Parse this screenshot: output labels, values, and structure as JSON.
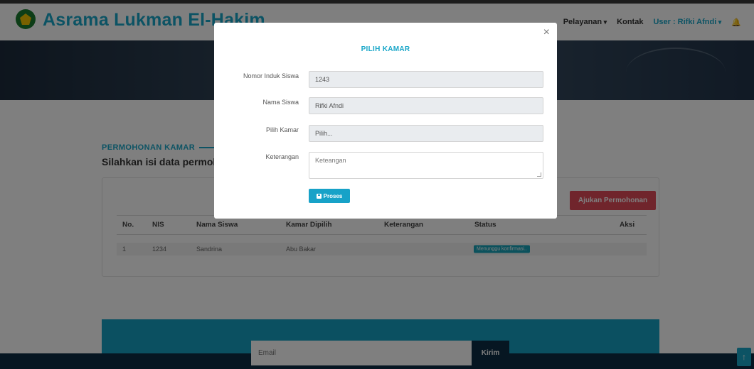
{
  "navbar": {
    "brand": "Asrama Lukman El-Hakim",
    "links": {
      "pelayanan": "Pelayanan",
      "kontak": "Kontak",
      "user": "User : Rifki Afndi"
    }
  },
  "section": {
    "tag": "PERMOHONAN KAMAR",
    "title": "Silahkan isi data permohonan"
  },
  "card": {
    "ajukan_label": "Ajukan Permohonan",
    "columns": [
      "No.",
      "NIS",
      "Nama Siswa",
      "Kamar Dipilih",
      "Keterangan",
      "Status",
      "Aksi"
    ],
    "rows": [
      {
        "no": "1",
        "nis": "1234",
        "nama": "Sandrina",
        "kamar": "Abu Bakar",
        "keterangan": "",
        "status": "Menunggu konfirmasi.."
      }
    ]
  },
  "footer": {
    "email_placeholder": "Email",
    "kirim_label": "Kirim"
  },
  "modal": {
    "title": "PILIH KAMAR",
    "close": "×",
    "fields": {
      "nis_label": "Nomor Induk Siswa",
      "nis_value": "1243",
      "nama_label": "Nama Siswa",
      "nama_value": "Rifki Afndi",
      "kamar_label": "Pilih Kamar",
      "kamar_value": "Pilih...",
      "keterangan_label": "Keterangan",
      "keterangan_placeholder": "Keteangan"
    },
    "submit_label": "Proses"
  },
  "icons": {
    "logo": "mosque-emblem-icon",
    "bell": "bell-icon",
    "save": "floppy-save-icon",
    "scroll_top": "arrow-up-icon"
  },
  "colors": {
    "primary": "#18a6c8",
    "danger": "#e04a59",
    "dark": "#0d2d44"
  }
}
